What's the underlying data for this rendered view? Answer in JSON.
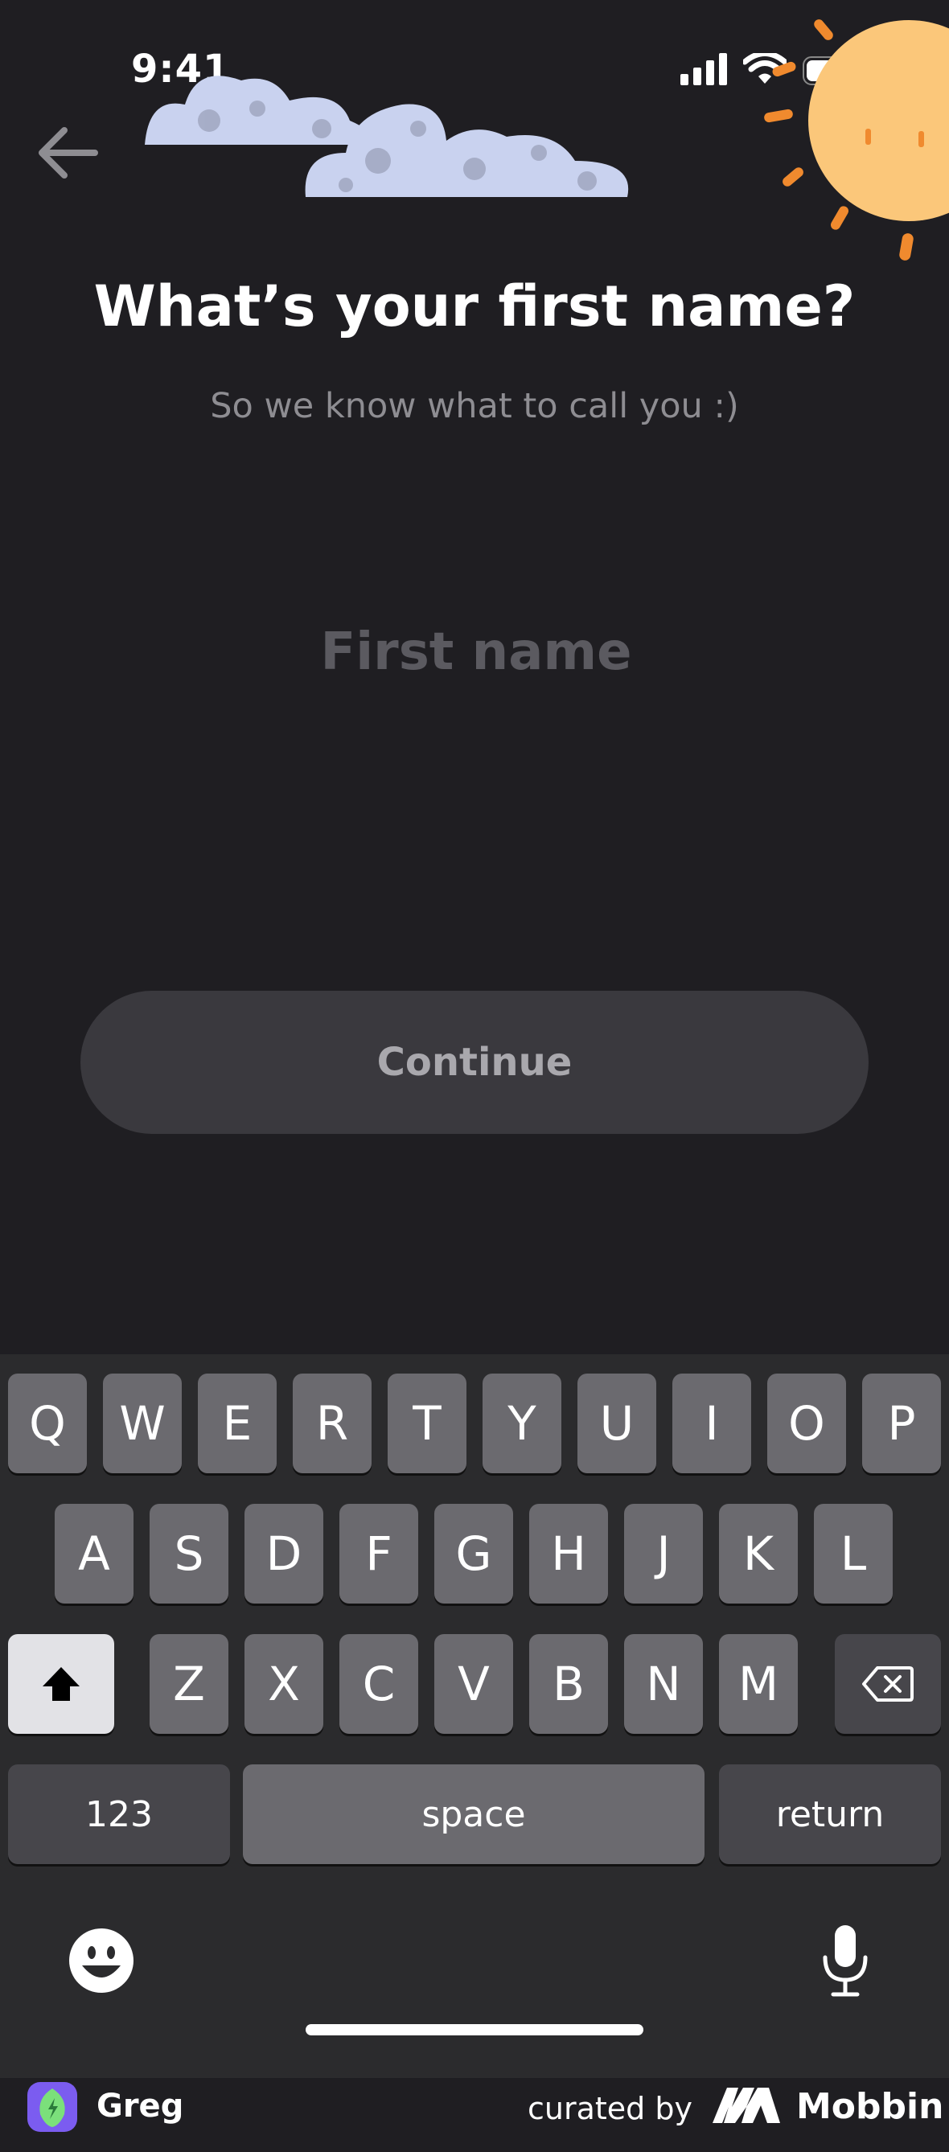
{
  "status_bar": {
    "time": "9:41"
  },
  "header": {
    "title": "What’s your first name?",
    "subtitle": "So we know what to call you :)"
  },
  "form": {
    "name_placeholder": "First name",
    "name_value": "",
    "continue_label": "Continue"
  },
  "keyboard": {
    "row1": [
      "Q",
      "W",
      "E",
      "R",
      "T",
      "Y",
      "U",
      "I",
      "O",
      "P"
    ],
    "row2": [
      "A",
      "S",
      "D",
      "F",
      "G",
      "H",
      "J",
      "K",
      "L"
    ],
    "row3": [
      "Z",
      "X",
      "C",
      "V",
      "B",
      "N",
      "M"
    ],
    "numbers_label": "123",
    "space_label": "space",
    "return_label": "return"
  },
  "footer": {
    "app_name": "Greg",
    "curated_by": "curated by",
    "brand": "Mobbin"
  },
  "colors": {
    "background": "#1f1e22",
    "button": "#3a393e",
    "key": "#6b6a6f",
    "sun": "#fbc77a",
    "app_icon": "#7b5cf0"
  }
}
